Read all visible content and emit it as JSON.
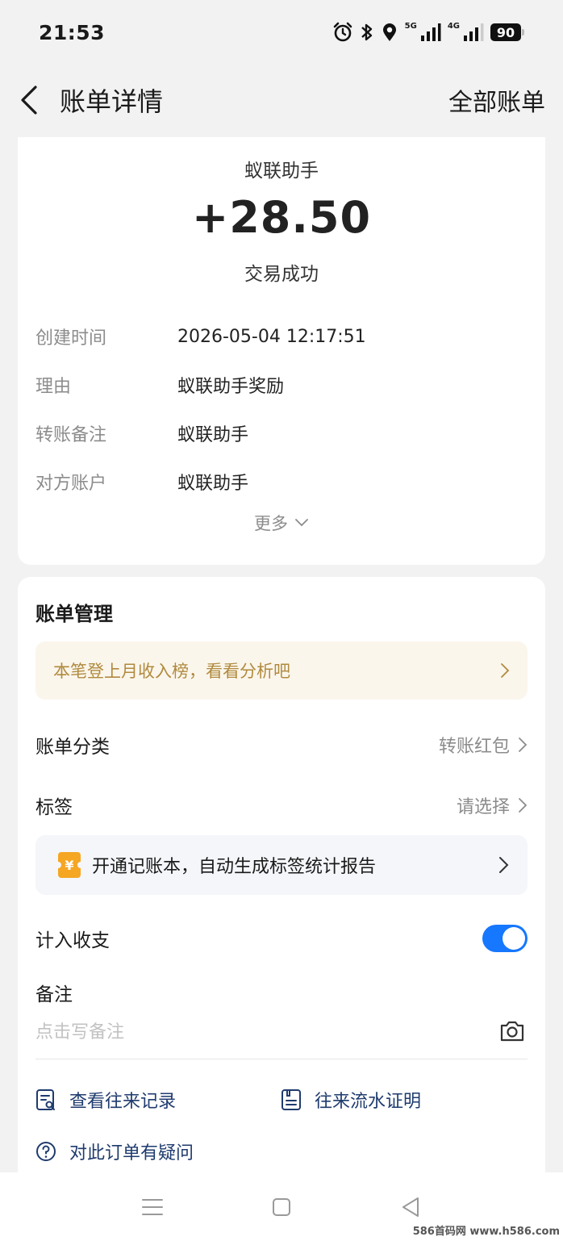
{
  "status_bar": {
    "time": "21:53",
    "net1": "5G",
    "net2": "4G",
    "battery": "90"
  },
  "header": {
    "title": "账单详情",
    "right_link": "全部账单"
  },
  "detail": {
    "payee": "蚁联助手",
    "amount": "+28.50",
    "status": "交易成功",
    "rows": [
      {
        "label": "创建时间",
        "value": "2026-05-04 12:17:51"
      },
      {
        "label": "理由",
        "value": "蚁联助手奖励"
      },
      {
        "label": "转账备注",
        "value": "蚁联助手"
      },
      {
        "label": "对方账户",
        "value": "蚁联助手"
      }
    ],
    "more": "更多"
  },
  "management": {
    "title": "账单管理",
    "rank_banner": "本笔登上月收入榜，看看分析吧",
    "category": {
      "label": "账单分类",
      "value": "转账红包"
    },
    "tags": {
      "label": "标签",
      "value": "请选择"
    },
    "promo": {
      "icon_text": "¥",
      "text": "开通记账本，自动生成标签统计报告"
    },
    "count_in": {
      "label": "计入收支",
      "enabled": true
    },
    "note": {
      "label": "备注",
      "placeholder": "点击写备注"
    },
    "actions": {
      "history": "查看往来记录",
      "proof": "往来流水证明",
      "question": "对此订单有疑问"
    }
  },
  "colors": {
    "accent": "#1677ff",
    "link": "#1f3b6e",
    "rank_text": "#b08a3e",
    "rank_bg": "#fbf6ec",
    "promo_icon": "#f5a623"
  },
  "watermark": "586首码网 www.h586.com"
}
